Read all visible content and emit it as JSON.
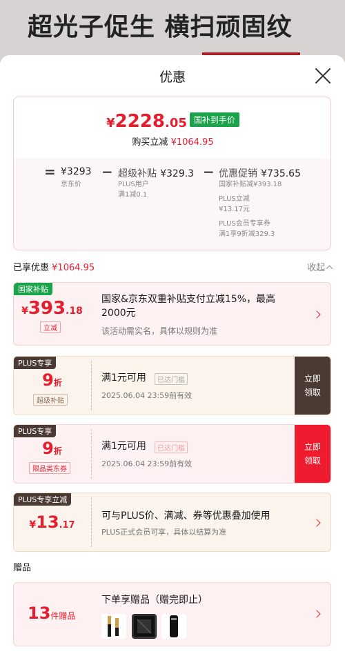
{
  "background": {
    "banner_text": "超光子促生 横扫顽固纹"
  },
  "header": {
    "title": "优惠"
  },
  "summary": {
    "price_symbol": "¥",
    "price_int": "2228",
    "price_dec": ".05",
    "badge": "国补到手价",
    "buy_label": "购买立减",
    "buy_value": "¥1064.95",
    "jd_price_value": "¥3293",
    "jd_price_label": "京东价",
    "super_label": "超级补贴",
    "super_value": "¥329.3",
    "super_sub1": "PLUS用户",
    "super_sub2": "满1减0.1",
    "promo_label": "优惠促销",
    "promo_value": "¥735.65",
    "promo_sub1": "国家补贴减¥393.18",
    "promo_sub2": "PLUS立减",
    "promo_sub3": "¥13.17元",
    "promo_sub4": "PLUS会员专享券",
    "promo_sub5": "满1享9折减329.3",
    "op_eq": "=",
    "op_minus1": "−",
    "op_minus2": "−"
  },
  "enjoyed": {
    "label": "已享优惠",
    "value": "¥1064.95",
    "collapse": "收起"
  },
  "coupons": [
    {
      "tag": "国家补贴",
      "sym": "¥",
      "int": "393",
      "dec": ".18",
      "chip": "立减",
      "line1": "国家&京东双重补贴支付立减15%，最高",
      "line1b": "2000元",
      "line2": "该活动需实名，具体以规则为准"
    },
    {
      "tag": "PLUS专享",
      "int": "9",
      "unit": "折",
      "chip": "超级补贴",
      "line1": "满1元可用",
      "reach": "已达门槛",
      "line2": "2025.06.04 23:59前有效",
      "claim1": "立即",
      "claim2": "领取"
    },
    {
      "tag": "PLUS专享",
      "int": "9",
      "unit": "折",
      "chip": "限品类东券",
      "line1": "满1元可用",
      "reach": "已达门槛",
      "line2": "2025.06.04 23:59前有效",
      "claim1": "立即",
      "claim2": "领取"
    },
    {
      "tag": "PLUS专享立减",
      "sym": "¥",
      "int": "13",
      "dec": ".17",
      "line1": "可与PLUS价、满减、券等优惠叠加使用",
      "line2": "PLUS正式会员可享，具体以结算为准"
    }
  ],
  "gifts": {
    "section": "赠品",
    "count": "13",
    "unit": "件赠品",
    "title": "下单享赠品（赠完即止）",
    "thumbs": [
      "gift-thumb-1",
      "gift-thumb-2",
      "gift-thumb-3"
    ]
  },
  "colors": {
    "accent": "#e41e2f",
    "green": "#19a34a",
    "brown": "#4b3a33"
  }
}
